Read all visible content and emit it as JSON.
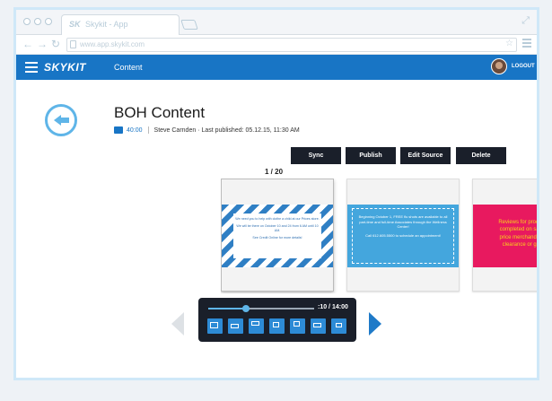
{
  "browser": {
    "tab_logo": "SK",
    "tab_title": "Skykit - App",
    "url": "www.app.skykit.com"
  },
  "appbar": {
    "brand": "SKYKIT",
    "section": "Content",
    "logout_label": "LOGOUT"
  },
  "content": {
    "title": "BOH Content",
    "duration": "40:00",
    "author": "Steve Carnden",
    "published": "Last published: 05.12.15, 11:30 AM"
  },
  "actions": [
    {
      "label": "Sync"
    },
    {
      "label": "Publish"
    },
    {
      "label": "Edit Source"
    },
    {
      "label": "Delete"
    }
  ],
  "slider": {
    "counter": "1 / 20",
    "slides": [
      {
        "lines": [
          "We need you to help with clothe a child at our Prices store.",
          "We will be there on October 10 and 24 from 6 AM until 10 AM.",
          "See Credit Online for more details!"
        ]
      },
      {
        "lines": [
          "Beginning October 1, FREE flu shots are available to all part-time and full-time Associates through the Wellness Center!",
          "Call 612.605.5500 to schedule an appointment!"
        ]
      },
      {
        "lines": [
          "Reviews for produc",
          "completed on sale",
          "price merchandise",
          "clearance or gift"
        ]
      }
    ]
  },
  "player": {
    "time": ":10 / 14:00",
    "progress": 0.36,
    "position_buttons": [
      "full",
      "bottom",
      "top",
      "bottom-center",
      "top-center",
      "center",
      "right"
    ]
  },
  "colors": {
    "brand_blue": "#1875c5",
    "accent_blue": "#5fb5e8",
    "dark": "#1a1f2a"
  }
}
